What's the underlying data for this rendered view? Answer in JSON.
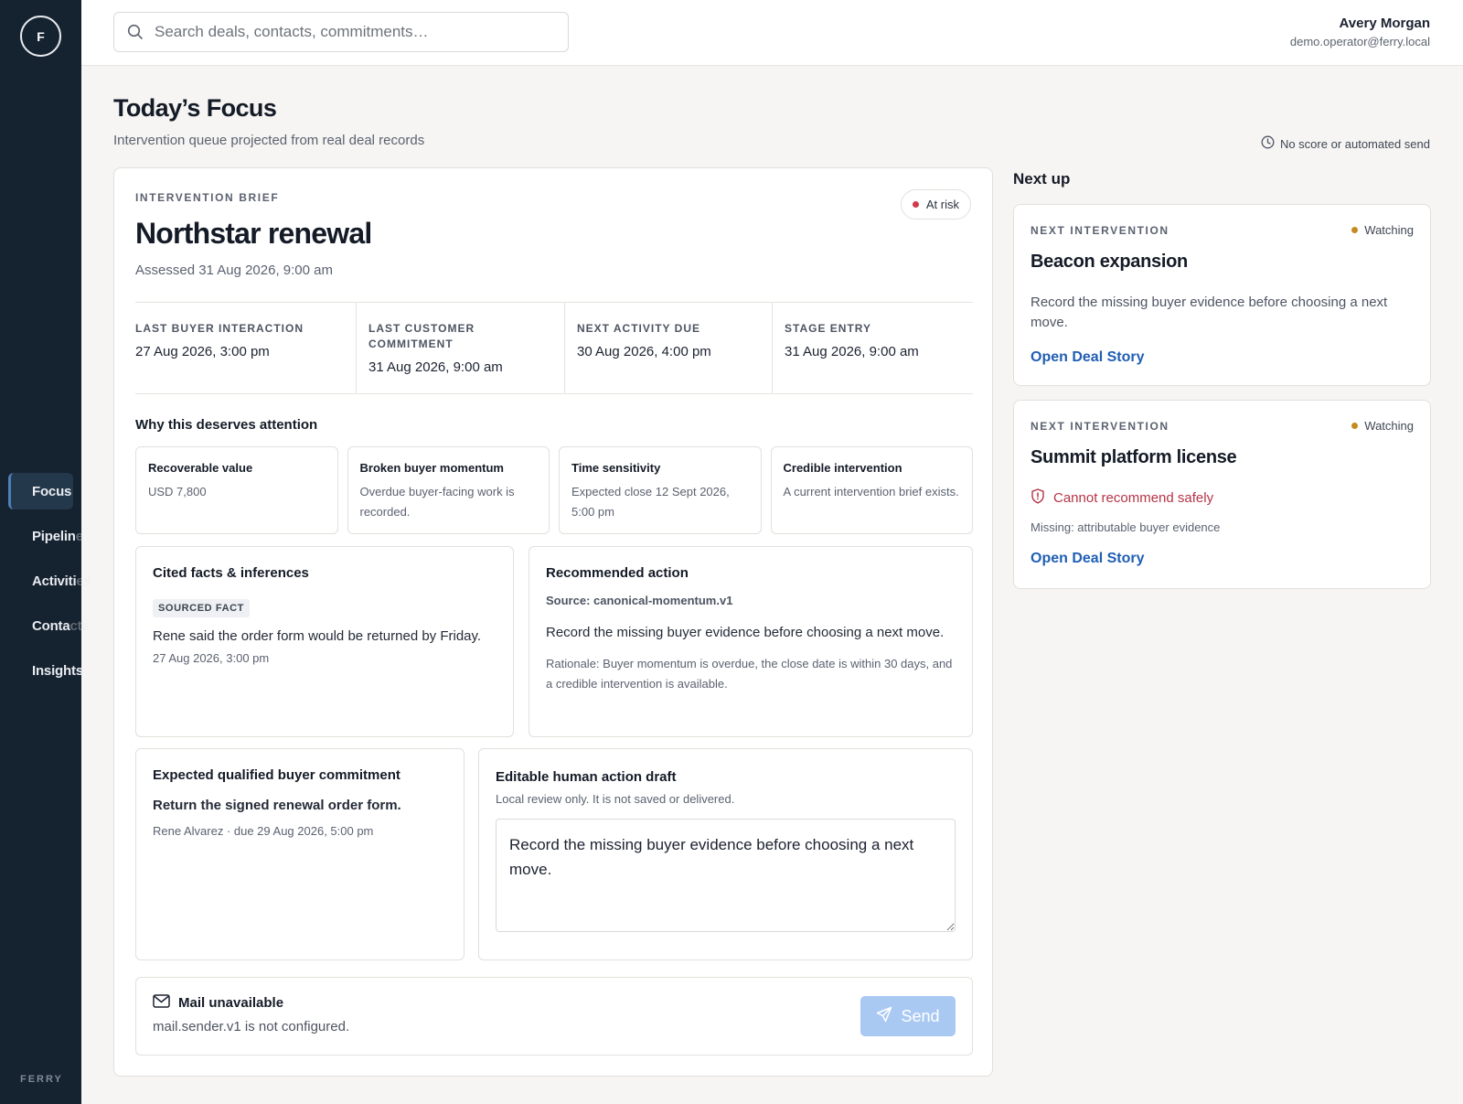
{
  "sidebar": {
    "logo_letter": "F",
    "items": [
      {
        "label": "Focus",
        "shown": "Focus",
        "faded": ""
      },
      {
        "label": "Pipeline",
        "shown": "Pipelin",
        "faded": "e"
      },
      {
        "label": "Activities",
        "shown": "Activiti",
        "faded": "es"
      },
      {
        "label": "Contacts",
        "shown": "Conta",
        "faded": "cts"
      },
      {
        "label": "Insights",
        "shown": "Insights",
        "faded": ""
      }
    ],
    "brand": "FERRY"
  },
  "topbar": {
    "search_placeholder": "Search deals, contacts, commitments…",
    "user_name": "Avery Morgan",
    "user_email": "demo.operator@ferry.local"
  },
  "page": {
    "title": "Today’s Focus",
    "subtitle": "Intervention queue projected from real deal records",
    "notice": "No score or automated send"
  },
  "brief": {
    "eyebrow": "INTERVENTION BRIEF",
    "title": "Northstar renewal",
    "assessed": "Assessed 31 Aug 2026, 9:00 am",
    "status": "At risk",
    "status_color": "#d2394a",
    "meta": [
      {
        "label": "LAST BUYER INTERACTION",
        "value": "27 Aug 2026, 3:00 pm"
      },
      {
        "label": "LAST CUSTOMER COMMITMENT",
        "value": "31 Aug 2026, 9:00 am"
      },
      {
        "label": "NEXT ACTIVITY DUE",
        "value": "30 Aug 2026, 4:00 pm"
      },
      {
        "label": "STAGE ENTRY",
        "value": "31 Aug 2026, 9:00 am"
      }
    ],
    "why_title": "Why this deserves attention",
    "why": [
      {
        "title": "Recoverable value",
        "desc": "USD 7,800"
      },
      {
        "title": "Broken buyer momentum",
        "desc": "Overdue buyer-facing work is recorded."
      },
      {
        "title": "Time sensitivity",
        "desc": "Expected close 12 Sept 2026, 5:00 pm"
      },
      {
        "title": "Credible intervention",
        "desc": "A current intervention brief exists."
      }
    ],
    "cited": {
      "title": "Cited facts & inferences",
      "badge": "SOURCED FACT",
      "text": "Rene said the order form would be returned by Friday.",
      "date": "27 Aug 2026, 3:00 pm"
    },
    "recommended": {
      "title": "Recommended action",
      "source": "Source: canonical-momentum.v1",
      "action": "Record the missing buyer evidence before choosing a next move.",
      "rationale": "Rationale: Buyer momentum is overdue, the close date is within 30 days, and a credible intervention is available."
    },
    "commitment": {
      "title": "Expected qualified buyer commitment",
      "text": "Return the signed renewal order form.",
      "who": "Rene Alvarez · due 29 Aug 2026, 5:00 pm"
    },
    "draft": {
      "title": "Editable human action draft",
      "subtitle": "Local review only. It is not saved or delivered.",
      "value": "Record the missing buyer evidence before choosing a next move."
    },
    "mail": {
      "title": "Mail unavailable",
      "subtitle": "mail.sender.v1 is not configured.",
      "send_label": "Send"
    }
  },
  "next_up": {
    "title": "Next up",
    "cards": [
      {
        "eyebrow": "NEXT INTERVENTION",
        "status": "Watching",
        "title": "Beacon expansion",
        "desc": "Record the missing buyer evidence before choosing a next move.",
        "link": "Open Deal Story"
      },
      {
        "eyebrow": "NEXT INTERVENTION",
        "status": "Watching",
        "title": "Summit platform license",
        "warning": "Cannot recommend safely",
        "missing": "Missing: attributable buyer evidence",
        "link": "Open Deal Story"
      }
    ],
    "status_color": "#c48a1e"
  }
}
